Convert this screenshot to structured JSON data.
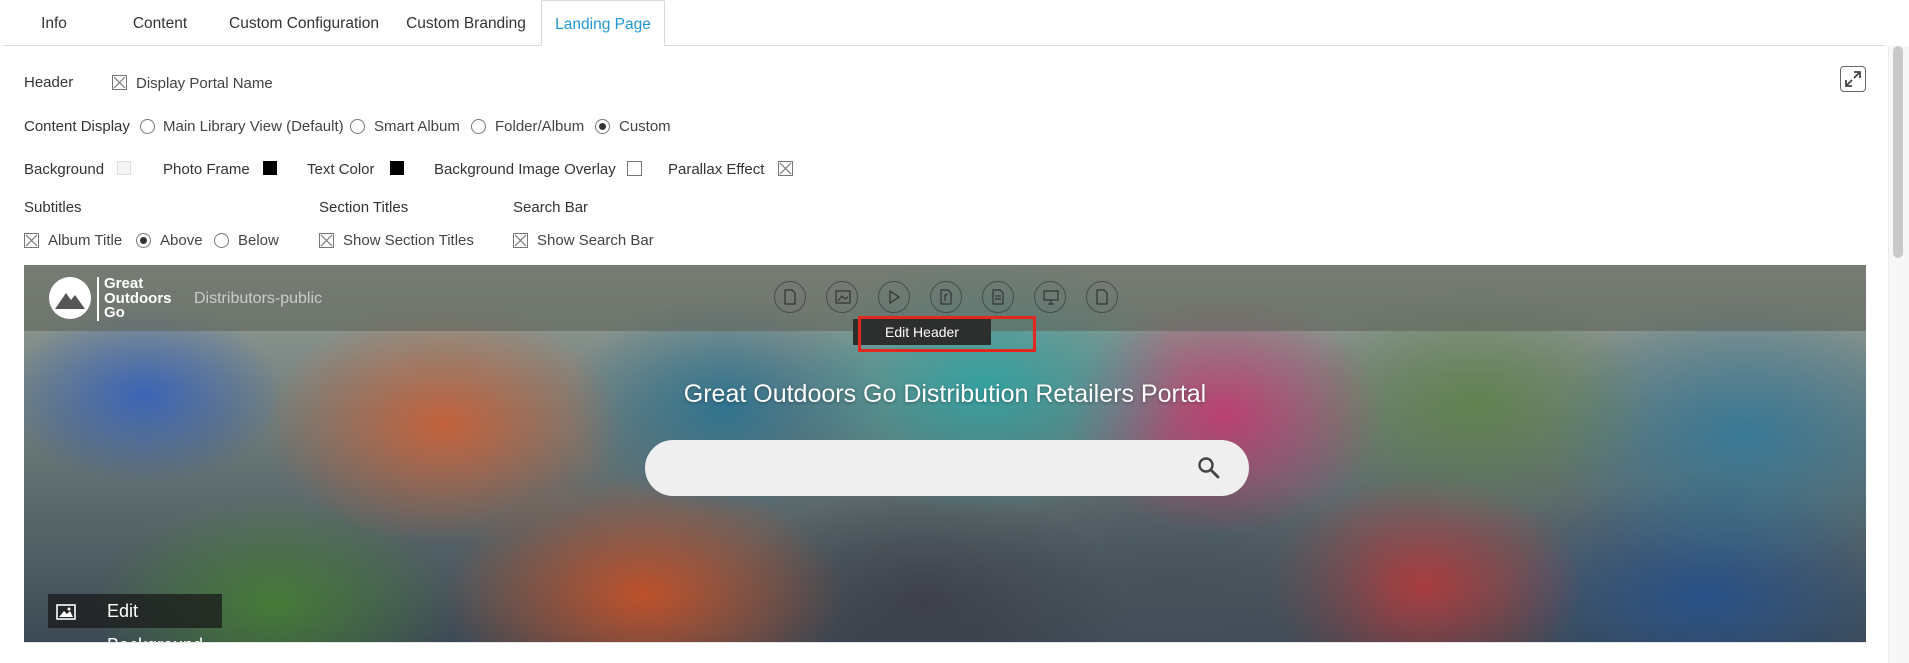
{
  "tabs": [
    {
      "label": "Info"
    },
    {
      "label": "Content"
    },
    {
      "label": "Custom Configuration"
    },
    {
      "label": "Custom Branding"
    },
    {
      "label": "Landing Page",
      "active": true
    }
  ],
  "header_row": {
    "label": "Header",
    "display_portal_name": {
      "label": "Display Portal Name",
      "checked": true
    }
  },
  "content_display": {
    "label": "Content Display",
    "options": [
      {
        "label": "Main Library View (Default)",
        "selected": false
      },
      {
        "label": "Smart Album",
        "selected": false
      },
      {
        "label": "Folder/Album",
        "selected": false
      },
      {
        "label": "Custom",
        "selected": true
      }
    ]
  },
  "style_row": {
    "background": {
      "label": "Background",
      "color": "#f3f3f3"
    },
    "photo_frame": {
      "label": "Photo Frame",
      "color": "#000000"
    },
    "text_color": {
      "label": "Text Color",
      "color": "#000000"
    },
    "background_image_overlay": {
      "label": "Background Image Overlay",
      "checked": false
    },
    "parallax_effect": {
      "label": "Parallax Effect",
      "checked": true
    }
  },
  "subtitles": {
    "label": "Subtitles",
    "album_title": {
      "label": "Album Title",
      "checked": true
    },
    "position_options": [
      {
        "label": "Above",
        "selected": true
      },
      {
        "label": "Below",
        "selected": false
      }
    ]
  },
  "section_titles": {
    "label": "Section Titles",
    "show": {
      "label": "Show Section Titles",
      "checked": true
    }
  },
  "search_bar": {
    "label": "Search Bar",
    "show": {
      "label": "Show Search Bar",
      "checked": true
    }
  },
  "preview": {
    "logo_text": "Great Outdoors Go",
    "portal_name": "Distributors-public",
    "nav_icons": [
      "document-icon",
      "image-icon",
      "video-icon",
      "audio-icon",
      "file-icon",
      "presentation-icon",
      "other-file-icon"
    ],
    "edit_header_label": "Edit Header",
    "portal_title": "Great Outdoors Go Distribution Retailers Portal",
    "search_placeholder": "",
    "edit_background_label": "Edit Background",
    "highlight_color": "#e0281e"
  }
}
